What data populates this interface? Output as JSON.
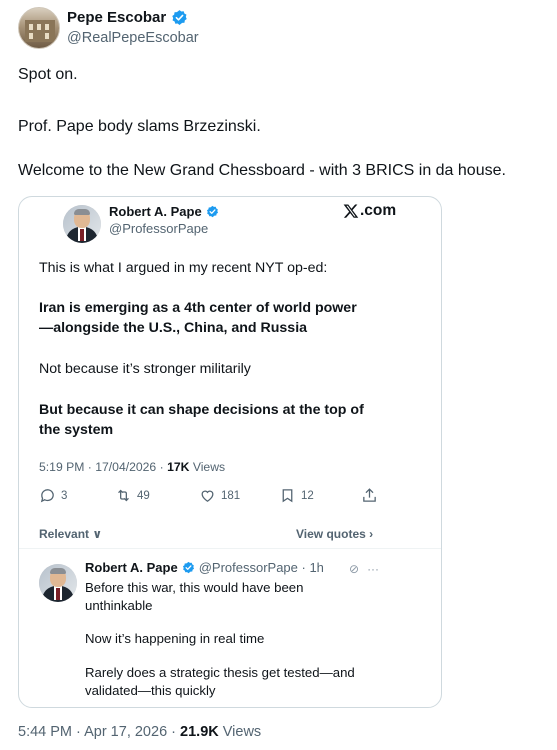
{
  "post": {
    "author_name": "Pepe Escobar",
    "author_handle": "@RealPepeEscobar",
    "text_lines": [
      "Spot on.",
      "Prof. Pape body slams Brzezinski.",
      "Welcome to the New Grand Chessboard - with 3 BRICS in da house."
    ],
    "time": "5:44 PM",
    "date": "Apr 17, 2026",
    "views_count": "21.9K",
    "views_label": "Views"
  },
  "quoted": {
    "author_name": "Robert A. Pape",
    "author_handle": "@ProfessorPape",
    "source_logo_text": ".com",
    "lines": [
      "This is what I argued in my recent NYT op-ed:",
      "Iran is emerging as a 4th center of world power",
      "—alongside the U.S., China, and Russia",
      "Not because it’s stronger militarily",
      "But because it can shape decisions at the top of",
      "the system"
    ],
    "meta_time": "5:19 PM · 17/04/2026 ·",
    "meta_views_count": "17K",
    "meta_views_label": "Views",
    "actions": {
      "replies": "3",
      "reposts": "49",
      "likes": "181",
      "bookmarks": "12"
    },
    "relevant_label": "Relevant ∨",
    "view_quotes_label": "View quotes ›",
    "reply": {
      "author_name": "Robert A. Pape",
      "handle_time": "@ProfessorPape · 1h",
      "lines": [
        "Before this war, this would have been",
        "unthinkable",
        "Now it’s happening in real time",
        "Rarely does a strategic thesis get tested—and",
        "validated—this quickly"
      ]
    }
  },
  "colors": {
    "text": "#0f1419",
    "secondary": "#536471",
    "verified": "#1d9bf0",
    "border": "#cfd9de"
  }
}
